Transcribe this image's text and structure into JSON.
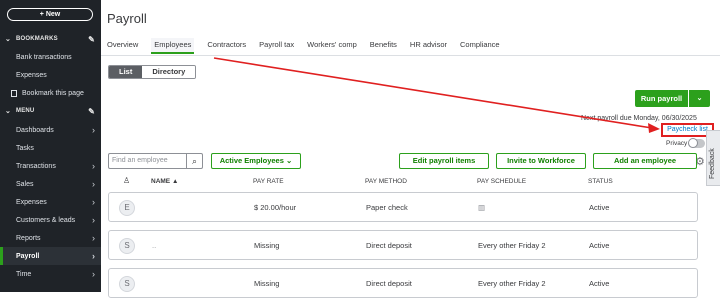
{
  "sidebar": {
    "new_label": "+ New",
    "bookmarks_header": "BOOKMARKS",
    "bookmark_items": [
      "Bank transactions",
      "Expenses",
      "Bookmark this page"
    ],
    "menu_header": "MENU",
    "menu_items": [
      "Dashboards",
      "Tasks",
      "Transactions",
      "Sales",
      "Expenses",
      "Customers & leads",
      "Reports",
      "Payroll",
      "Time"
    ],
    "active_item": "Payroll"
  },
  "page": {
    "title": "Payroll",
    "tabs": [
      "Overview",
      "Employees",
      "Contractors",
      "Payroll tax",
      "Workers' comp",
      "Benefits",
      "HR advisor",
      "Compliance"
    ],
    "active_tab": "Employees"
  },
  "toggle": {
    "list": "List",
    "directory": "Directory"
  },
  "run_payroll": {
    "label": "Run payroll",
    "dropdown_icon": "chevron-down-icon"
  },
  "due_text": "Next payroll due Monday, 06/30/2025",
  "paycheck_list": "Paycheck list",
  "privacy": "Privacy",
  "feedback": "Feedback",
  "toolbar": {
    "search_placeholder": "Find an employee",
    "filter_label": "Active Employees",
    "edit_payroll_items": "Edit payroll items",
    "invite_workforce": "Invite to Workforce",
    "add_employee": "Add an employee"
  },
  "table": {
    "columns": [
      "NAME ▲",
      "PAY RATE",
      "PAY METHOD",
      "PAY SCHEDULE",
      "STATUS"
    ],
    "rows": [
      {
        "initial": "E",
        "name": "",
        "pay_rate": "$ 20.00/hour",
        "pay_method": "Paper check",
        "pay_schedule": "▥",
        "status": "Active"
      },
      {
        "initial": "S",
        "name": "..",
        "pay_rate": "Missing",
        "pay_method": "Direct deposit",
        "pay_schedule": "Every other Friday 2",
        "status": "Active"
      },
      {
        "initial": "S",
        "name": "",
        "pay_rate": "Missing",
        "pay_method": "Direct deposit",
        "pay_schedule": "Every other Friday 2",
        "status": "Active"
      }
    ]
  },
  "colors": {
    "accent_green": "#2ca01c",
    "link_blue": "#0077c5",
    "annotation_red": "#e02020",
    "sidebar_bg": "#1f2328"
  }
}
